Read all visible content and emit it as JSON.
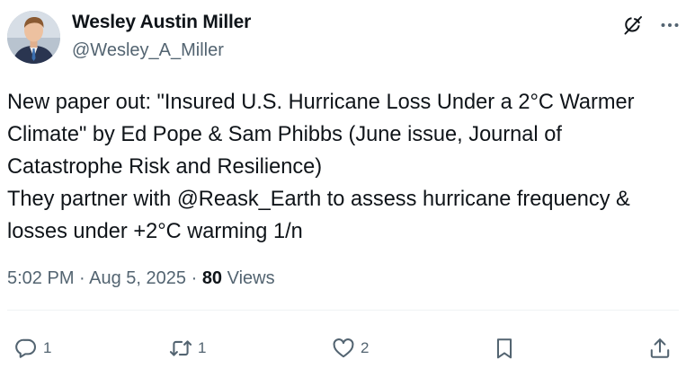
{
  "author": {
    "display_name": "Wesley Austin Miller",
    "handle": "@Wesley_A_Miller"
  },
  "header_icons": {
    "grok": "grok-icon",
    "more": "more-icon"
  },
  "tweet": {
    "line1": "New paper out: \"Insured U.S. Hurricane Loss Under a 2°C Warmer",
    "line2": "Climate\" by Ed Pope & Sam Phibbs (June issue, Journal of",
    "line3": "Catastrophe Risk and Resilience)",
    "line4_prefix": "They partner with ",
    "mention": "@Reask_Earth",
    "line4_suffix": " to assess hurricane frequency &",
    "line5": "losses under +2°C warming 1/n"
  },
  "meta": {
    "time": "5:02 PM",
    "separator": " · ",
    "date": "Aug 5, 2025",
    "views_count": "80",
    "views_label": " Views"
  },
  "actions": {
    "reply_count": "1",
    "retweet_count": "1",
    "like_count": "2"
  },
  "colors": {
    "text": "#0f1419",
    "secondary": "#536471",
    "divider": "#eff3f4"
  }
}
